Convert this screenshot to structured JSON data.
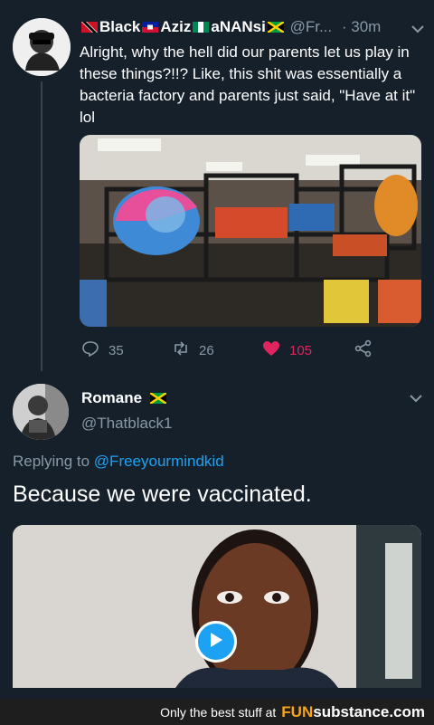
{
  "tweet1": {
    "display_name": "Black",
    "display_name_2": "Aziz",
    "display_name_3": "aNANsi",
    "handle": "@Fr...",
    "time": "· 30m",
    "text": "Alright, why the hell did our parents let us play in these things?!!? Like, this shit was essentially a bacteria factory and parents just said, \"Have at it\" lol",
    "actions": {
      "replies": "35",
      "retweets": "26",
      "likes": "105"
    }
  },
  "tweet2": {
    "display_name": "Romane",
    "handle": "@Thatblack1",
    "replying_label": "Replying to",
    "replying_to": "@Freeyourmindkid",
    "text": "Because we were vaccinated."
  },
  "footer": {
    "text": "Only the best stuff at",
    "brand_fun": "FUN",
    "brand_sub": "substance.com"
  },
  "colors": {
    "background": "#15202b",
    "accent": "#1da1f2",
    "like": "#e0245e",
    "muted": "#8899a6"
  },
  "icons": [
    "reply-icon",
    "retweet-icon",
    "heart-icon",
    "share-icon",
    "chevron-down-icon",
    "play-icon"
  ]
}
